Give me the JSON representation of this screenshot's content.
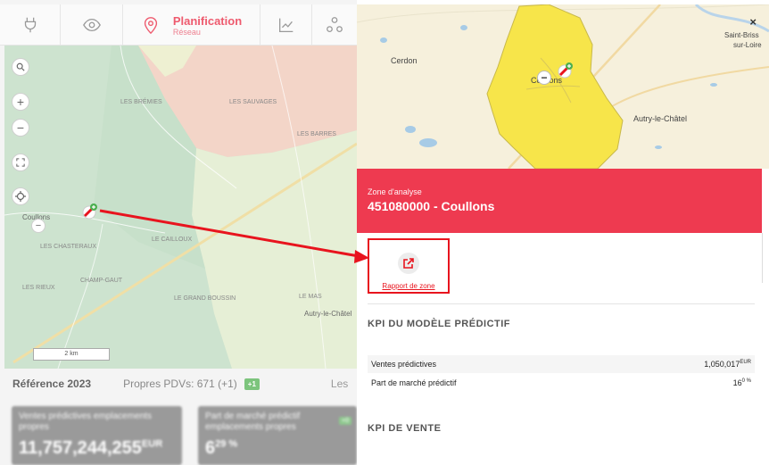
{
  "nav": {
    "active_title": "Planification",
    "active_subtitle": "Réseau"
  },
  "map_left": {
    "label_place": "Coullons",
    "label_place_2": "Autry-le-Châtel",
    "small_labels": [
      "LES BRÉMIES",
      "LES SAUVAGES",
      "LE CAILLOUX",
      "CHAMP-GAUT",
      "LES CHASTERAUX",
      "LE GRAND BOUSSIN",
      "LES BARRES",
      "LE MAS",
      "LES RIEUX"
    ],
    "scale": "2 km"
  },
  "reference": {
    "title": "Référence 2023",
    "pdv": "Propres PDVs: 671 (+1)",
    "badge": "+1",
    "les": "Les"
  },
  "cards": [
    {
      "label": "Ventes prédictives emplacements propres",
      "value": "11,757,244,255",
      "unit": "EUR"
    },
    {
      "label": "Part de marché prédictif emplacements propres",
      "value": "6",
      "unit": "29 %",
      "badge": "+0"
    }
  ],
  "map_right": {
    "labels": {
      "cerdon": "Cerdon",
      "coullons": "Coullons",
      "autry": "Autry-le-Châtel",
      "saint_briss": "Saint-Briss",
      "sur_loire": "sur-Loire"
    },
    "close": "×",
    "zone_color": "#f7e54a"
  },
  "zone": {
    "label": "Zone d'analyse",
    "title": "451080000 - Coullons",
    "color": "#ee3a50"
  },
  "report": {
    "label": "Rapport de zone"
  },
  "kpi_model": {
    "title": "KPI DU MODÈLE PRÉDICTIF",
    "rows": [
      {
        "label": "Ventes prédictives",
        "value": "1,050,017",
        "unit": "EUR"
      },
      {
        "label": "Part de marché prédictif",
        "value": "16",
        "unit": "0 %"
      }
    ]
  },
  "kpi_sales": {
    "title": "KPI DE VENTE"
  },
  "highlight_color": "#e8141e"
}
